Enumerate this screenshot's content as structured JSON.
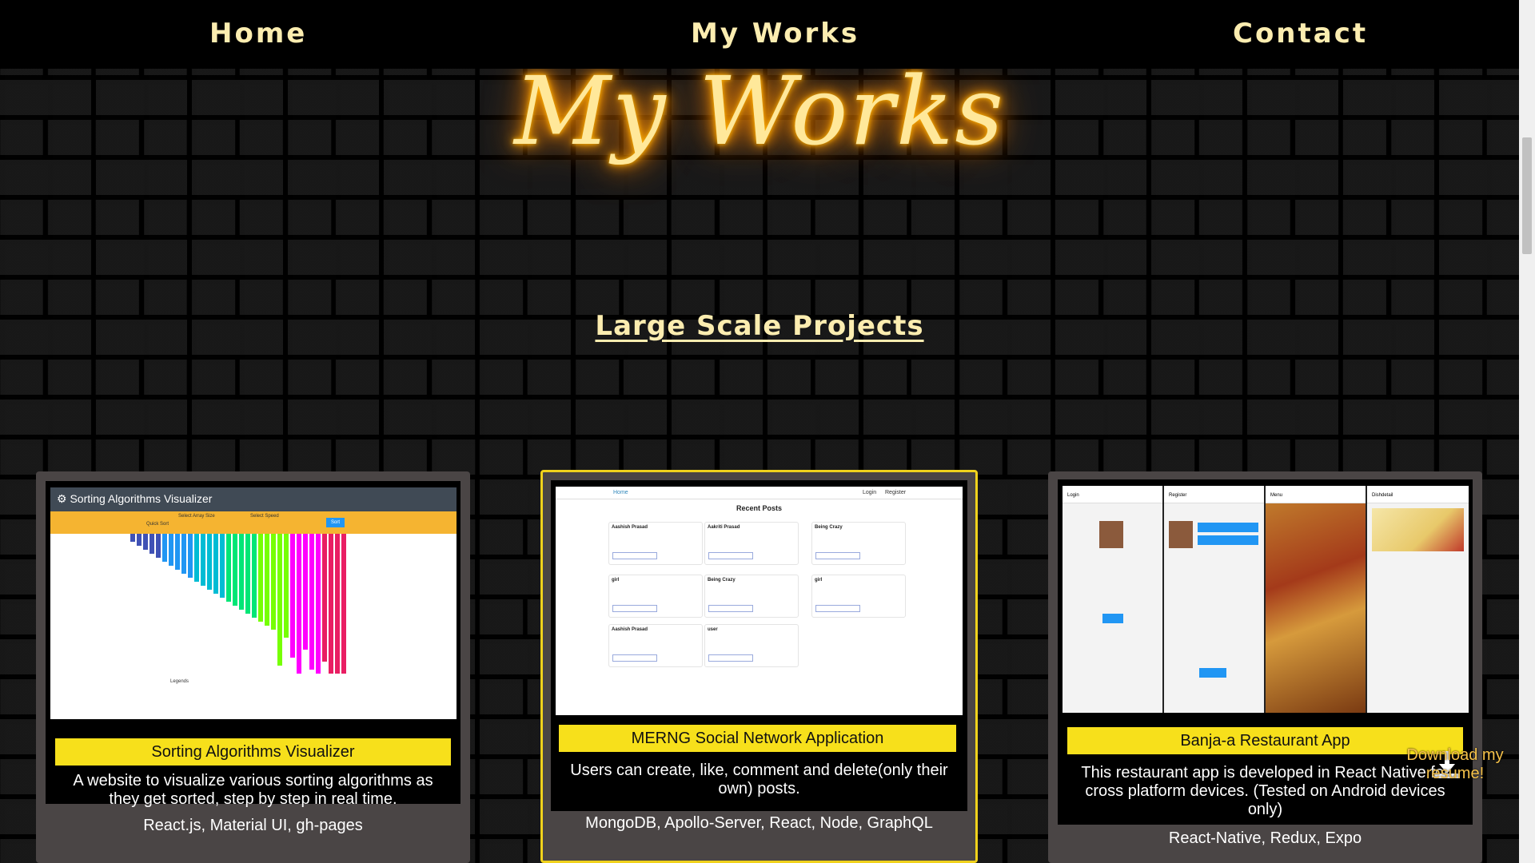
{
  "nav": {
    "home": "Home",
    "works": "My Works",
    "contact": "Contact"
  },
  "hero": {
    "title": "My Works"
  },
  "section": {
    "title": "Large Scale Projects"
  },
  "projects": [
    {
      "title": "Sorting Algorithms Visualizer",
      "description": "A website to visualize various sorting algorithms as they get sorted, step by step in real time.",
      "tech": "React.js, Material UI, gh-pages",
      "shot": {
        "app_name": "Sorting Algorithms Visualizer",
        "select_size": "Select Array Size",
        "select_speed": "Select Speed",
        "algo": "Quick Sort",
        "sort": "Sort",
        "legends": "Legends"
      }
    },
    {
      "title": "MERNG Social Network Application",
      "description": "Users can create, like, comment and delete(only their own) posts.",
      "tech": "MongoDB, Apollo-Server, React, Node, GraphQL",
      "shot": {
        "home": "Home",
        "login": "Login",
        "register": "Register",
        "heading": "Recent Posts",
        "authors": [
          "Aashish Prasad",
          "Aakriti Prasad",
          "Being Crazy",
          "girl",
          "Being Crazy",
          "girl",
          "Aashish Prasad",
          "user"
        ]
      }
    },
    {
      "title": "Banja-a Restaurant App",
      "description": "This restaurant app is developed in React Native for cross platform devices. (Tested on Android devices only)",
      "tech": "React-Native, Redux, Expo",
      "shot": {
        "screens": [
          "Login",
          "Register",
          "Menu",
          "Dishdetail"
        ]
      }
    }
  ],
  "download": {
    "label": "Download my resume!"
  },
  "colors": {
    "neon": "#ffe89a",
    "accent": "#f7e01b",
    "nav_text": "#fcedb0",
    "card": "#4a4545"
  }
}
